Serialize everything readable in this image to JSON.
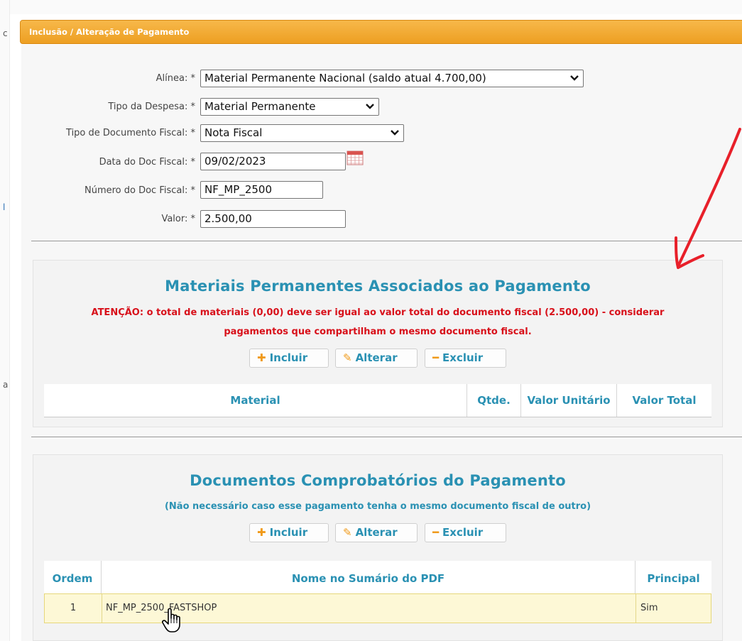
{
  "window": {
    "title": "Inclusão / Alteração de Pagamento"
  },
  "left_strip_chars": [
    "c",
    "l",
    "a"
  ],
  "form": {
    "alinea": {
      "label": "Alínea: *",
      "value": "Material Permanente Nacional (saldo atual 4.700,00)"
    },
    "tipo_despesa": {
      "label": "Tipo da Despesa: *",
      "value": "Material Permanente"
    },
    "tipo_documento": {
      "label": "Tipo de Documento Fiscal: *",
      "value": "Nota Fiscal"
    },
    "data_doc": {
      "label": "Data do Doc Fiscal: *",
      "value": "09/02/2023"
    },
    "numero_doc": {
      "label": "Número do Doc Fiscal: *",
      "value": "NF_MP_2500"
    },
    "valor": {
      "label": "Valor: *",
      "value": "2.500,00"
    }
  },
  "materiais": {
    "title": "Materiais Permanentes Associados ao Pagamento",
    "warning_line1": "ATENÇÃO: o total de materiais (0,00) deve ser igual ao valor total do documento fiscal (2.500,00) - considerar",
    "warning_line2": "pagamentos que compartilham o mesmo documento fiscal.",
    "buttons": {
      "incluir": "Incluir",
      "alterar": "Alterar",
      "excluir": "Excluir"
    },
    "columns": [
      "Material",
      "Qtde.",
      "Valor Unitário",
      "Valor Total"
    ]
  },
  "documentos": {
    "title": "Documentos Comprobatórios do Pagamento",
    "subtitle": "(Não necessário caso esse pagamento tenha o mesmo documento fiscal de outro)",
    "buttons": {
      "incluir": "Incluir",
      "alterar": "Alterar",
      "excluir": "Excluir"
    },
    "columns": [
      "Ordem",
      "Nome no Sumário do PDF",
      "Principal"
    ],
    "rows": [
      {
        "ordem": "1",
        "nome": "NF_MP_2500_FASTSHOP",
        "principal": "Sim"
      }
    ]
  },
  "colors": {
    "title_bar": "#ed9f22",
    "section_title": "#2a91b3",
    "warning": "#d8101a",
    "button_icon": "#f09a1a",
    "annotation_arrow": "#e8202a"
  }
}
